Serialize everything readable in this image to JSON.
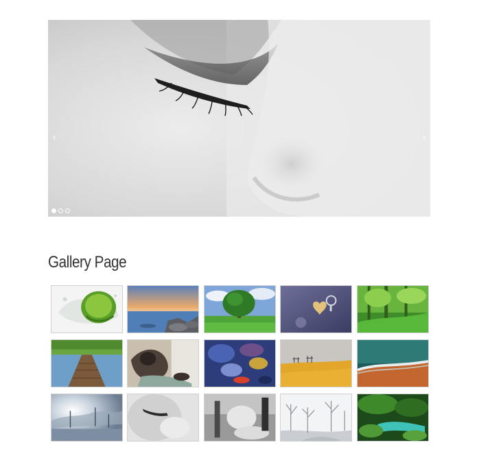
{
  "slider": {
    "prev_icon": "‹",
    "next_icon": "›",
    "slide_count": 3,
    "active_slide": 1
  },
  "gallery": {
    "title": "Gallery Page",
    "thumbnail_count": 15
  },
  "icons": {
    "prev": "chevron-left-icon",
    "next": "chevron-right-icon"
  }
}
